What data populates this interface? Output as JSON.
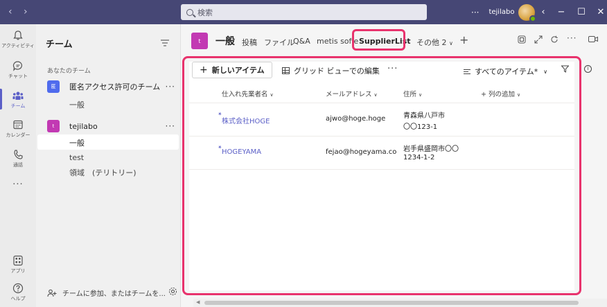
{
  "titlebar": {
    "search_placeholder": "検索",
    "more": "···",
    "user": "tejilabo",
    "window_buttons": [
      "‹",
      "−",
      "☐",
      "✕"
    ]
  },
  "rail": [
    {
      "label": "アクティビティ",
      "icon": "bell-icon"
    },
    {
      "label": "チャット",
      "icon": "chat-icon"
    },
    {
      "label": "チーム",
      "icon": "teams-icon",
      "active": true
    },
    {
      "label": "カレンダー",
      "icon": "calendar-icon"
    },
    {
      "label": "通話",
      "icon": "phone-icon"
    },
    {
      "label": "···",
      "icon": "more-icon"
    },
    {
      "label": "アプリ",
      "icon": "apps-icon"
    },
    {
      "label": "ヘルプ",
      "icon": "help-icon"
    }
  ],
  "panel": {
    "title": "チーム",
    "section_label": "あなたのチーム",
    "teams": [
      {
        "avatar": "匿",
        "name": "匿名アクセス許可のチーム",
        "color": "#4f6bed",
        "channels": [
          "一般"
        ]
      },
      {
        "avatar": "t",
        "name": "tejilabo",
        "color": "#c239b3",
        "channels": [
          "一般",
          "test",
          "領域　(テリトリー)"
        ]
      }
    ],
    "join": "チームに参加、またはチームを..."
  },
  "channel": {
    "avatar": "t",
    "name": "一般",
    "tabs": [
      "投稿",
      "ファイル",
      "Q&A",
      "metis sofie",
      "SupplierList",
      "その他 2"
    ],
    "add_tab": "+"
  },
  "list": {
    "new_item": "新しいアイテム",
    "grid_edit": "グリッド ビューでの編集",
    "more": "···",
    "view": "すべてのアイテム*",
    "columns": [
      "仕入れ先業者名",
      "メールアドレス",
      "住所",
      "+ 列の追加"
    ],
    "rows": [
      {
        "name": "株式会社HOGE",
        "email": "ajwo@hoge.hoge",
        "addr1": "青森県八戸市",
        "addr2": "〇〇123-1"
      },
      {
        "name": "HOGEYAMA",
        "email": "fejao@hogeyama.co",
        "addr1": "岩手県盛岡市〇〇",
        "addr2": "1234-1-2"
      }
    ]
  },
  "colors": {
    "accent": "#5b5fc7",
    "highlight": "#e8336d",
    "titlebar": "#464775"
  }
}
